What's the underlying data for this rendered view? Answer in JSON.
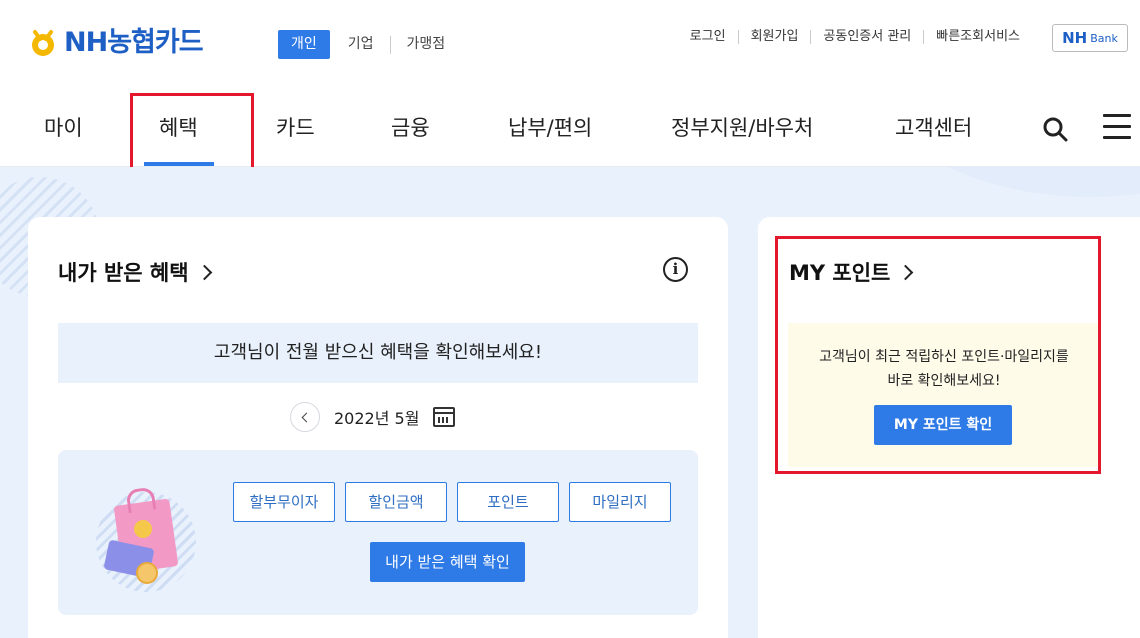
{
  "header": {
    "logo_text": "NH농협카드",
    "segments": [
      "개인",
      "기업",
      "가맹점"
    ],
    "util_links": [
      "로그인",
      "회원가입",
      "공동인증서 관리",
      "빠른조회서비스"
    ],
    "nhbank": {
      "nh": "NH",
      "bank": "Bank"
    }
  },
  "nav": {
    "items": [
      "마이",
      "혜택",
      "카드",
      "금융",
      "납부/편의",
      "정부지원/바우처",
      "고객센터"
    ],
    "active": "혜택"
  },
  "benefit_card": {
    "title": "내가 받은 혜택",
    "info_glyph": "i",
    "banner": "고객님이 전월 받으신 혜택을 확인해보세요!",
    "date": "2022년 5월",
    "chips": [
      "할부무이자",
      "할인금액",
      "포인트",
      "마일리지"
    ],
    "button": "내가 받은 혜택 확인"
  },
  "point_card": {
    "title": "MY 포인트",
    "text_line1": "고객님이 최근 적립하신 포인트·마일리지를",
    "text_line2": "바로 확인해보세요!",
    "button": "MY 포인트 확인"
  },
  "colors": {
    "primary": "#2e7ae6",
    "brand": "#1d5fc4",
    "highlight": "#e3182d"
  }
}
